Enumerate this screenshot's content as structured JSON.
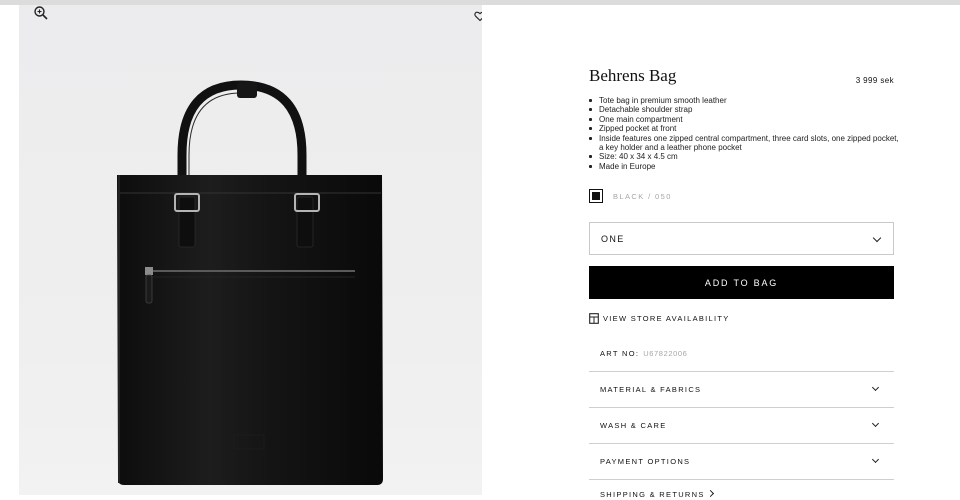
{
  "product": {
    "name": "Behrens Bag",
    "price": "3 999 sek",
    "features": [
      "Tote bag in premium smooth leather",
      "Detachable shoulder strap",
      "One main compartment",
      "Zipped pocket at front",
      "Inside features one zipped central compartment, three card slots, one zipped pocket, a key holder and a leather phone pocket",
      "Size: 40 x 34 x 4.5 cm",
      "Made in Europe"
    ]
  },
  "color": {
    "label": "BLACK / 050",
    "swatch": "#111111"
  },
  "size_select": {
    "value": "ONE"
  },
  "buttons": {
    "add_to_bag": "ADD TO BAG",
    "view_store": "VIEW STORE AVAILABILITY"
  },
  "art": {
    "label": "ART NO:",
    "value": "U67822006"
  },
  "accordion": [
    {
      "label": "MATERIAL & FABRICS"
    },
    {
      "label": "WASH & CARE"
    },
    {
      "label": "PAYMENT OPTIONS"
    }
  ],
  "shipping": {
    "label": "SHIPPING & RETURNS"
  },
  "icons": {
    "zoom": "zoom-in-icon",
    "wishlist": "heart-icon",
    "store": "store-icon",
    "chevron": "chevron-down-icon"
  }
}
